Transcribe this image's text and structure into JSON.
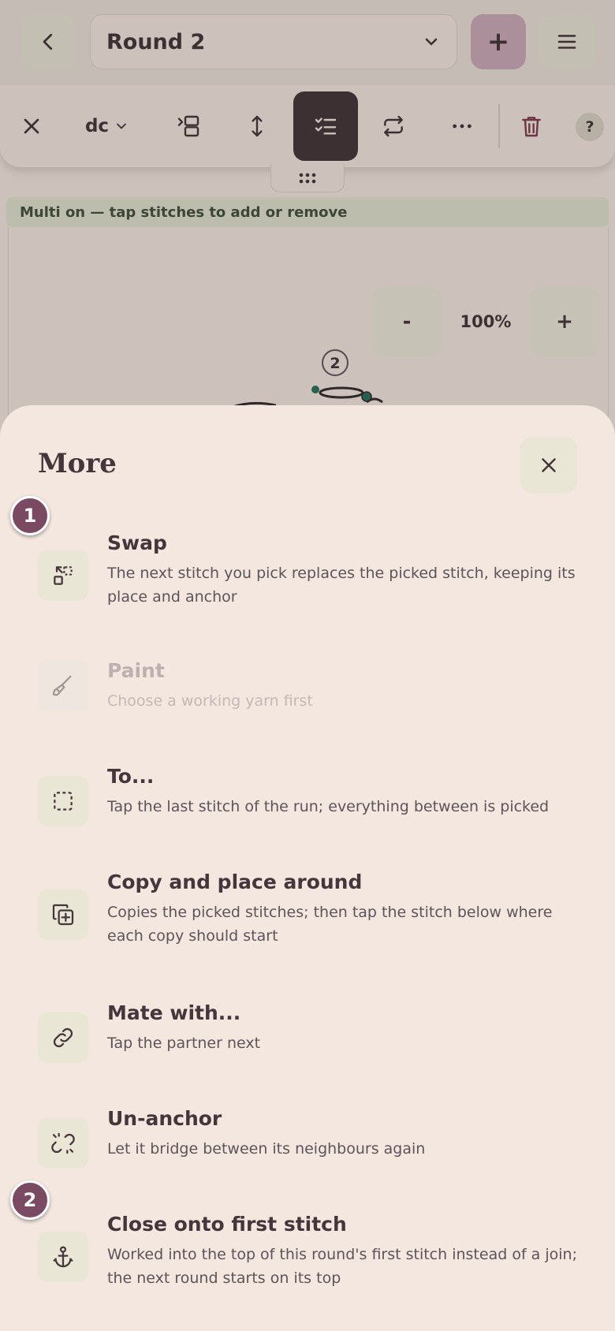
{
  "header": {
    "round_label": "Round 2",
    "add_label": "+"
  },
  "toolbar": {
    "stitch_label": "dc",
    "help_label": "?"
  },
  "banner": "Multi on — tap stitches to add or remove",
  "zoom": {
    "minus": "-",
    "level": "100%",
    "plus": "+"
  },
  "chart": {
    "round_marker": "2"
  },
  "sheet": {
    "title": "More",
    "items": [
      {
        "title": "Swap",
        "desc": "The next stitch you pick replaces the picked stitch, keeping its place and anchor",
        "icon": "swap-icon",
        "enabled": true
      },
      {
        "title": "Paint",
        "desc": "Choose a working yarn first",
        "icon": "paintbrush-icon",
        "enabled": false
      },
      {
        "title": "To...",
        "desc": "Tap the last stitch of the run; everything between is picked",
        "icon": "dashed-square-icon",
        "enabled": true
      },
      {
        "title": "Copy and place around",
        "desc": "Copies the picked stitches; then tap the stitch below where each copy should start",
        "icon": "copy-plus-icon",
        "enabled": true
      },
      {
        "title": "Mate with...",
        "desc": "Tap the partner next",
        "icon": "link-icon",
        "enabled": true
      },
      {
        "title": "Un-anchor",
        "desc": "Let it bridge between its neighbours again",
        "icon": "unlink-icon",
        "enabled": true
      },
      {
        "title": "Close onto first stitch",
        "desc": "Worked into the top of this round's first stitch instead of a join; the next round starts on its top",
        "icon": "anchor-icon",
        "enabled": true
      }
    ]
  },
  "badges": [
    "1",
    "2"
  ],
  "colors": {
    "accent": "#7a4a62",
    "active_tool": "#3c2d33",
    "sheet_bg": "#f4e7e0",
    "icon_bg": "#e9e6d6",
    "banner_bg": "#dfe2cf",
    "stitch_dot": "#1f6b55"
  }
}
